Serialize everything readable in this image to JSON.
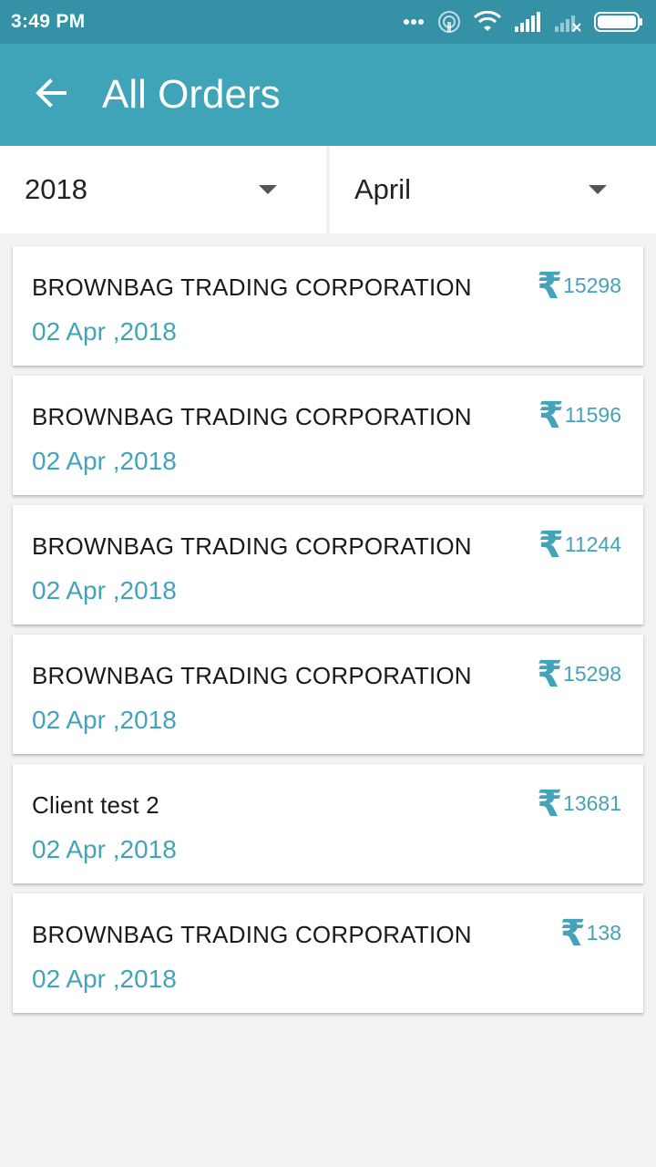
{
  "status_bar": {
    "time": "3:49 PM",
    "icons": [
      "more-dots-icon",
      "hotspot-icon",
      "wifi-icon",
      "signal-icon",
      "signal-no-sim-icon",
      "battery-icon"
    ]
  },
  "app_bar": {
    "back_icon": "arrow-left-icon",
    "title": "All Orders"
  },
  "filters": {
    "year": "2018",
    "month": "April"
  },
  "colors": {
    "status_bar": "#3591a5",
    "app_bar": "#40a4b9",
    "accent": "#44a3b8",
    "background": "#f2f2f2"
  },
  "orders": [
    {
      "client": "BROWNBAG TRADING CORPORATION",
      "date": "02 Apr ,2018",
      "currency_icon": "rupee-icon",
      "amount": "15298"
    },
    {
      "client": "BROWNBAG TRADING CORPORATION",
      "date": "02 Apr ,2018",
      "currency_icon": "rupee-icon",
      "amount": "11596"
    },
    {
      "client": "BROWNBAG TRADING CORPORATION",
      "date": "02 Apr ,2018",
      "currency_icon": "rupee-icon",
      "amount": "11244"
    },
    {
      "client": "BROWNBAG TRADING CORPORATION",
      "date": "02 Apr ,2018",
      "currency_icon": "rupee-icon",
      "amount": "15298"
    },
    {
      "client": "Client test 2",
      "date": "02 Apr ,2018",
      "currency_icon": "rupee-icon",
      "amount": "13681"
    },
    {
      "client": "BROWNBAG TRADING CORPORATION",
      "date": "02 Apr ,2018",
      "currency_icon": "rupee-icon",
      "amount": "138"
    }
  ]
}
